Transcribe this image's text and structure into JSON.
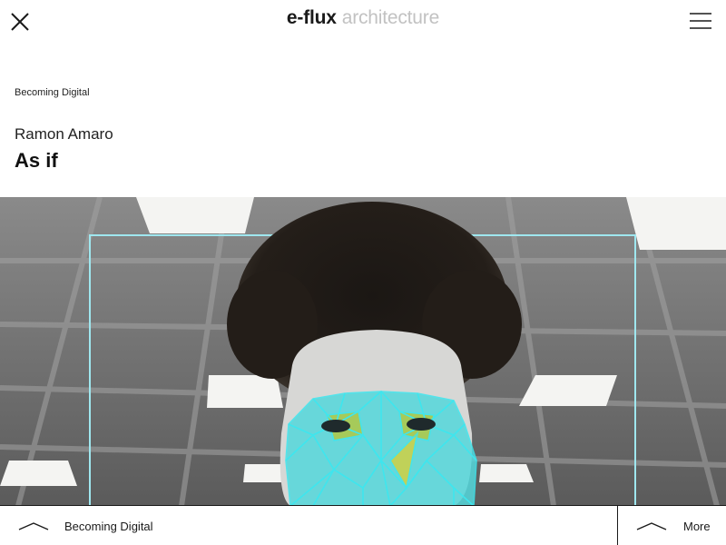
{
  "header": {
    "logo_main": "e-flux",
    "logo_sub": "architecture"
  },
  "article": {
    "kicker": "Becoming Digital",
    "author": "Ramon Amaro",
    "title": "As if"
  },
  "hero": {
    "alt": "Face-tracking mesh overlay on a white mask under office ceiling lights",
    "mesh_color": "#3ee6ee",
    "frame_color": "#9fe7ef"
  },
  "footer": {
    "left_label": "Becoming Digital",
    "right_label": "More"
  },
  "icons": {
    "close": "close-icon",
    "menu": "hamburger-menu-icon",
    "chevron": "chevron-up-icon"
  }
}
